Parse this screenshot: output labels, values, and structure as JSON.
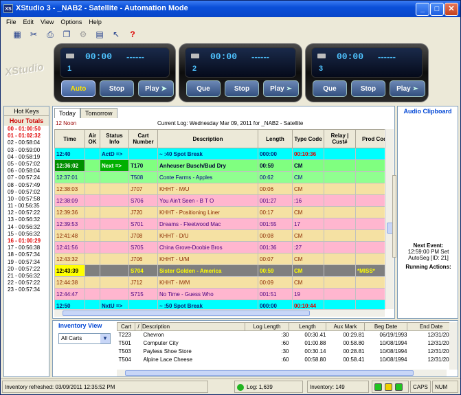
{
  "window": {
    "title": "XStudio 3 - _NAB2 - Satellite - Automation Mode",
    "app_icon": "XS"
  },
  "menu": [
    "File",
    "Edit",
    "View",
    "Options",
    "Help"
  ],
  "toolbar_icons": [
    "calendar-icon",
    "scissors-icon",
    "printer-icon",
    "copy-icon",
    "settings-icon",
    "document-icon",
    "whats-this-icon",
    "help-icon"
  ],
  "brand": "XStudio",
  "decks": [
    {
      "number": "1",
      "time": "00:00",
      "dash": "------",
      "buttons": [
        "Auto",
        "Stop",
        "Play"
      ],
      "active": "Auto"
    },
    {
      "number": "2",
      "time": "00:00",
      "dash": "------",
      "buttons": [
        "Que",
        "Stop",
        "Play"
      ],
      "active": ""
    },
    {
      "number": "3",
      "time": "00:00",
      "dash": "------",
      "buttons": [
        "Que",
        "Stop",
        "Play"
      ],
      "active": ""
    }
  ],
  "hotkeys": {
    "header": "Hot Keys",
    "subheader": "Hour Totals",
    "items": [
      {
        "text": "00 - 01:00:50",
        "alert": true
      },
      {
        "text": "01 - 01:02:32",
        "alert": true
      },
      {
        "text": "02 - 00:58:04",
        "alert": false
      },
      {
        "text": "03 - 00:59:00",
        "alert": false
      },
      {
        "text": "04 - 00:58:19",
        "alert": false
      },
      {
        "text": "05 - 00:57:02",
        "alert": false
      },
      {
        "text": "06 - 00:58:04",
        "alert": false
      },
      {
        "text": "07 - 00:57:24",
        "alert": false
      },
      {
        "text": "08 - 00:57:49",
        "alert": false
      },
      {
        "text": "09 - 00:57:02",
        "alert": false
      },
      {
        "text": "10 - 00:57:58",
        "alert": false
      },
      {
        "text": "11 - 00:56:35",
        "alert": false
      },
      {
        "text": "12 - 00:57:22",
        "alert": false
      },
      {
        "text": "13 - 00:56:32",
        "alert": false
      },
      {
        "text": "14 - 00:56:32",
        "alert": false
      },
      {
        "text": "15 - 00:56:32",
        "alert": false
      },
      {
        "text": "16 - 01:00:29",
        "alert": true
      },
      {
        "text": "17 - 00:56:38",
        "alert": false
      },
      {
        "text": "18 - 00:57:34",
        "alert": false
      },
      {
        "text": "19 - 00:57:34",
        "alert": false
      },
      {
        "text": "20 - 00:57:22",
        "alert": false
      },
      {
        "text": "21 - 00:56:32",
        "alert": false
      },
      {
        "text": "22 - 00:57:22",
        "alert": false
      },
      {
        "text": "23 - 00:57:34",
        "alert": false
      }
    ]
  },
  "log": {
    "tabs": [
      "Today",
      "Tomorrow"
    ],
    "hour_label": "12 Noon",
    "current_log": "Current Log: Wednesday Mar 09, 2011  for  _NAB2 - Satellite",
    "columns": [
      "Time",
      "Air OK",
      "Status Info",
      "Cart Number",
      "Description",
      "Length",
      "Type Code",
      "Relay | Cust#",
      "Prod Cod"
    ],
    "rows": [
      {
        "style": "cyan",
        "time": "12:40",
        "air": "",
        "status": "ActD =>",
        "cart": "",
        "desc": "~ :40 Spot Break",
        "length": "000:00",
        "type": "00:10:36",
        "type_red": true,
        "relay": "",
        "prod": ""
      },
      {
        "style": "green",
        "time": "12:36:02",
        "air": "",
        "status": "Next =>",
        "cart": "T170",
        "desc": "Anheuser Busch/Bud Dry",
        "length": "00:59",
        "type": "CM",
        "type_red": false,
        "relay": "",
        "prod": ""
      },
      {
        "style": "lime",
        "time": "12:37:01",
        "air": "",
        "status": "",
        "cart": "T508",
        "desc": "Conte Farms - Apples",
        "length": "00:62",
        "type": "CM",
        "type_red": false,
        "relay": "",
        "prod": ""
      },
      {
        "style": "tan",
        "time": "12:38:03",
        "air": "",
        "status": "",
        "cart": "J707",
        "desc": "KHHT - M/U",
        "length": "00:06",
        "type": "CM",
        "type_red": false,
        "relay": "",
        "prod": ""
      },
      {
        "style": "pink",
        "time": "12:38:09",
        "air": "",
        "status": "",
        "cart": "S706",
        "desc": "You Ain't Seen - B T O",
        "length": "001:27",
        "type": ":16",
        "type_red": false,
        "relay": "",
        "prod": ""
      },
      {
        "style": "tan",
        "time": "12:39:36",
        "air": "",
        "status": "",
        "cart": "J720",
        "desc": "KHHT - Positioning Liner",
        "length": "00:17",
        "type": "CM",
        "type_red": false,
        "relay": "",
        "prod": ""
      },
      {
        "style": "pink",
        "time": "12:39:53",
        "air": "",
        "status": "",
        "cart": "S701",
        "desc": "Dreams - Fleetwood Mac",
        "length": "001:55",
        "type": "17",
        "type_red": false,
        "relay": "",
        "prod": ""
      },
      {
        "style": "tan",
        "time": "12:41:48",
        "air": "",
        "status": "",
        "cart": "J708",
        "desc": "KHHT - D/U",
        "length": "00:08",
        "type": "CM",
        "type_red": false,
        "relay": "",
        "prod": ""
      },
      {
        "style": "pink",
        "time": "12:41:56",
        "air": "",
        "status": "",
        "cart": "S705",
        "desc": "China Grove-Doobie Bros",
        "length": "001:36",
        "type": ":27",
        "type_red": false,
        "relay": "",
        "prod": ""
      },
      {
        "style": "tan",
        "time": "12:43:32",
        "air": "",
        "status": "",
        "cart": "J706",
        "desc": "KHHT - U/M",
        "length": "00:07",
        "type": "CM",
        "type_red": false,
        "relay": "",
        "prod": ""
      },
      {
        "style": "miss",
        "time": "12:43:39",
        "air": "",
        "status": "",
        "cart": "S704",
        "desc": "Sister Golden - America",
        "length": "00:59",
        "type": "CM",
        "type_red": false,
        "relay": "",
        "prod": "*MISS*"
      },
      {
        "style": "tan",
        "time": "12:44:38",
        "air": "",
        "status": "",
        "cart": "J712",
        "desc": "KHHT - M/M",
        "length": "00:09",
        "type": "CM",
        "type_red": false,
        "relay": "",
        "prod": ""
      },
      {
        "style": "pink",
        "time": "12:44:47",
        "air": "",
        "status": "",
        "cart": "S715",
        "desc": "No Time - Guess Who",
        "length": "001:51",
        "type": "19",
        "type_red": false,
        "relay": "",
        "prod": ""
      },
      {
        "style": "cyan",
        "time": "12:50",
        "air": "",
        "status": "NxtU =>",
        "cart": "",
        "desc": "~ :50 Spot Break",
        "length": "000:00",
        "type": "00:10:44",
        "type_red": true,
        "relay": "",
        "prod": ""
      }
    ]
  },
  "clipboard": {
    "header": "Audio Clipboard",
    "next_event_label": "Next Event:",
    "next_event_time": "12:59:00 PM Set",
    "next_event_seg": "AutoSeg [ID: 21]",
    "running_label": "Running Actions:"
  },
  "inventory": {
    "label": "Inventory View",
    "filter": "All Carts",
    "columns": [
      "Cart",
      "/",
      "Description",
      "Log Length",
      "Length",
      "Aux Mark",
      "Beg Date",
      "End Date"
    ],
    "rows": [
      [
        "T223",
        "",
        "Chevron",
        ":30",
        "00:30.41",
        "00:29.81",
        "06/19/1993",
        "12/31/2037"
      ],
      [
        "T501",
        "",
        "Computer City",
        ":60",
        "01:00.88",
        "00:58.80",
        "10/08/1994",
        "12/31/2037"
      ],
      [
        "T503",
        "",
        "Payless Shoe Store",
        ":30",
        "00:30.14",
        "00:28.81",
        "10/08/1994",
        "12/31/2037"
      ],
      [
        "T504",
        "",
        "Alpine Lace Cheese",
        ":60",
        "00:58.80",
        "00:58.41",
        "10/08/1994",
        "12/31/2037"
      ]
    ]
  },
  "status": {
    "refreshed": "Inventory refreshed: 03/09/2011 12:35:52 PM",
    "log": "Log: 1,639",
    "inventory": "Inventory: 149",
    "caps": "CAPS",
    "num": "NUM"
  },
  "colors": {
    "title_blue": "#0a4fd8",
    "cyan_row": "#00ffff",
    "next_green": "#008f00",
    "tan_row": "#f5e1a3",
    "pink_row": "#ffb6cf",
    "miss_row": "#7f7f7f"
  }
}
